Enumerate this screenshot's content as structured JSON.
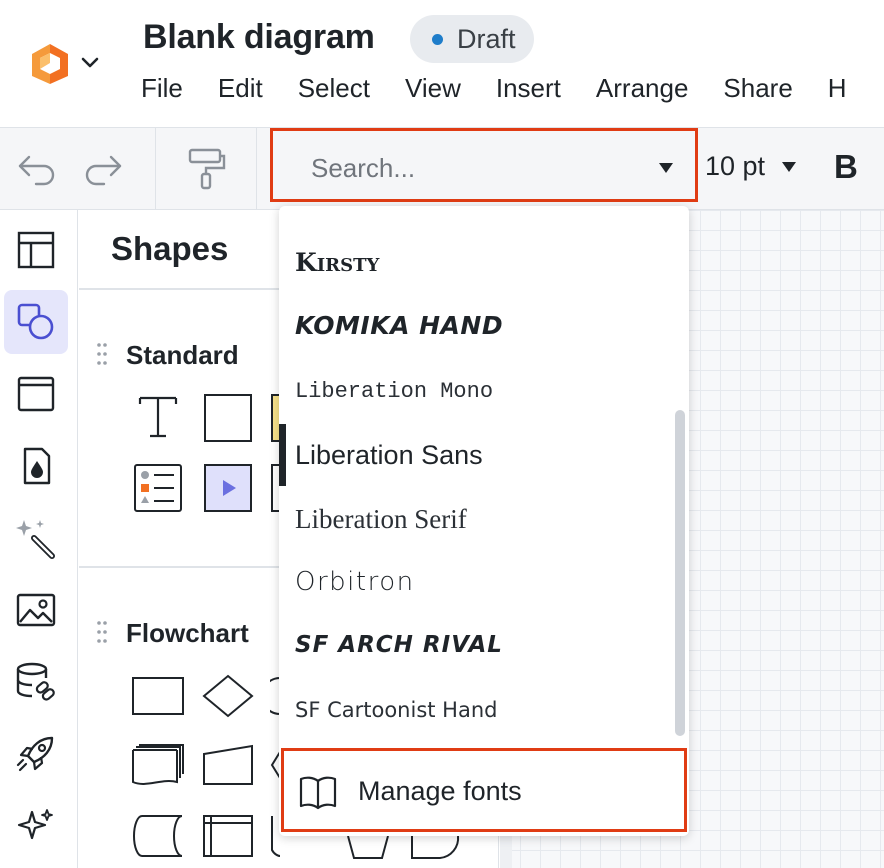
{
  "header": {
    "doc_title": "Blank diagram",
    "status_badge": "Draft",
    "menu": [
      "File",
      "Edit",
      "Select",
      "View",
      "Insert",
      "Arrange",
      "Share",
      "H"
    ]
  },
  "toolbar": {
    "font_search_placeholder": "Search...",
    "font_size": "10 pt",
    "bold_label": "B"
  },
  "shapes_panel": {
    "title": "Shapes",
    "sections": [
      {
        "title": "Standard"
      },
      {
        "title": "Flowchart"
      }
    ]
  },
  "font_dropdown": {
    "options": [
      {
        "label": "Kirsty"
      },
      {
        "label": "KOMIKA HAND"
      },
      {
        "label": "Liberation Mono"
      },
      {
        "label": "Liberation Sans"
      },
      {
        "label": "Liberation Serif"
      },
      {
        "label": "Orbitron"
      },
      {
        "label": "SF ARCH RIVAL"
      },
      {
        "label": "SF Cartoonist Hand"
      }
    ],
    "manage_fonts_label": "Manage fonts"
  },
  "colors": {
    "accent": "#e03c14",
    "logo_orange": "#f27022",
    "draft_dot": "#1e7dca",
    "active_rail": "#e5e6fb"
  },
  "icons": {
    "rail": [
      "page-layout-icon",
      "shapes-icon",
      "frame-icon",
      "fill-drop-icon",
      "magic-wand-icon",
      "image-icon",
      "data-link-icon",
      "rocket-icon",
      "sparkle-icon"
    ]
  }
}
